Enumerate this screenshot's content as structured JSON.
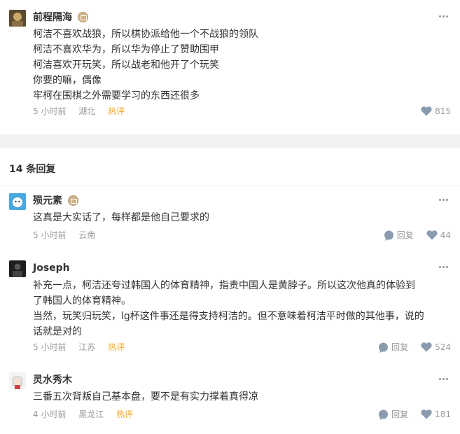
{
  "main_comment": {
    "author": "前程隔海",
    "lines": [
      "柯洁不喜欢战狼，所以棋协派给他一个不战狼的领队",
      "柯洁不喜欢华为，所以华为停止了赞助围甲",
      "柯洁喜欢开玩笑，所以战老和他开了个玩笑",
      "你要的嘛，偶像",
      "牢柯在围棋之外需要学习的东西还很多"
    ],
    "time": "5 小时前",
    "location": "湖北",
    "tag": "热评",
    "likes": "815"
  },
  "replies_header": "14 条回复",
  "replies": [
    {
      "author": "殒元素",
      "lines": [
        "这真是大实话了，每样都是他自己要求的"
      ],
      "time": "5 小时前",
      "location": "云南",
      "reply_label": "回复",
      "likes": "44"
    },
    {
      "author": "Joseph",
      "lines": [
        "补充一点，柯洁还夸过韩国人的体育精神，指责中国人是黄脖子。所以这次他真的体验到",
        "了韩国人的体育精神。",
        "当然，玩笑归玩笑，lg杯这件事还是得支持柯洁的。但不意味着柯洁平时做的其他事，说的",
        "话就是对的"
      ],
      "time": "5 小时前",
      "location": "江苏",
      "tag": "热评",
      "reply_label": "回复",
      "likes": "524"
    },
    {
      "author": "灵水秀木",
      "lines": [
        "三番五次背叛自己基本盘，要不是有实力撑着真得凉"
      ],
      "time": "4 小时前",
      "location": "黑龙江",
      "tag": "热评",
      "reply_label": "回复",
      "likes": "181"
    }
  ],
  "colors": {
    "hot_tag": "#f5a623",
    "meta_text": "#999999",
    "divider": "#f2f2f2"
  }
}
